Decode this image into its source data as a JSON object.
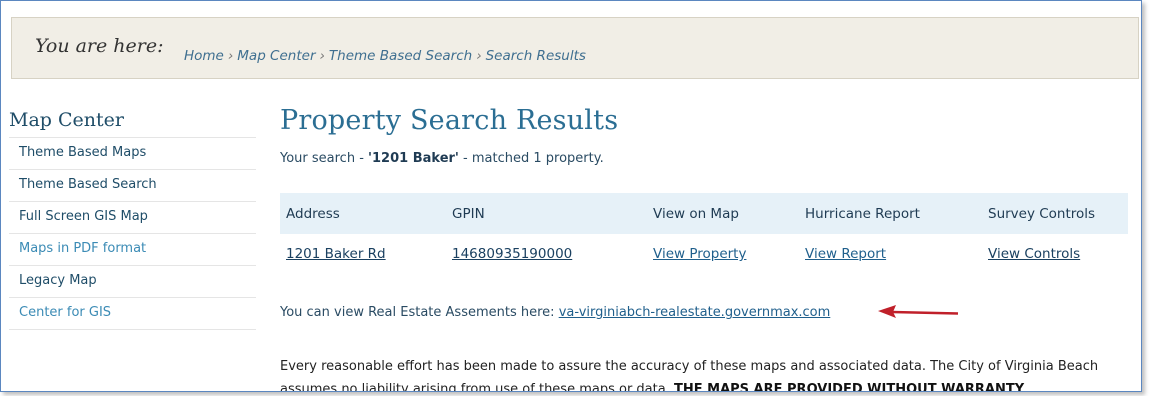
{
  "breadcrumb": {
    "label": "You are here:",
    "items": [
      "Home",
      "Map Center",
      "Theme Based Search",
      "Search Results"
    ],
    "separator": "›"
  },
  "sidebar": {
    "title": "Map Center",
    "items": [
      {
        "label": "Theme Based Maps"
      },
      {
        "label": "Theme Based Search"
      },
      {
        "label": "Full Screen GIS Map"
      },
      {
        "label": "Maps in PDF format"
      },
      {
        "label": "Legacy Map"
      },
      {
        "label": "Center for GIS"
      }
    ]
  },
  "main": {
    "title": "Property Search Results",
    "summary": {
      "prefix": "Your search -",
      "query": "'1201 Baker'",
      "suffix": "- matched 1 property."
    },
    "table": {
      "headers": [
        "Address",
        "GPIN",
        "View on Map",
        "Hurricane Report",
        "Survey Controls"
      ],
      "rows": [
        {
          "address": "1201 Baker Rd",
          "gpin": "14680935190000",
          "map": "View Property",
          "report": "View Report",
          "controls": "View Controls"
        }
      ]
    },
    "assessments": {
      "text": "You can view Real Estate Assements here:",
      "link": "va-virginiabch-realestate.governmax.com"
    },
    "disclaimer": {
      "text": "Every reasonable effort has been made to assure the accuracy of these maps and associated data. The City of Virginia Beach assumes no liability arising from use of these maps or data.",
      "bold": "THE MAPS ARE PROVIDED WITHOUT WARRANTY"
    }
  },
  "colors": {
    "accent": "#2b6e93",
    "link": "#1f5f8c",
    "arrow": "#c0202a",
    "breadcrumb_bg": "#f1eee6",
    "table_header_bg": "#e6f1f8"
  }
}
